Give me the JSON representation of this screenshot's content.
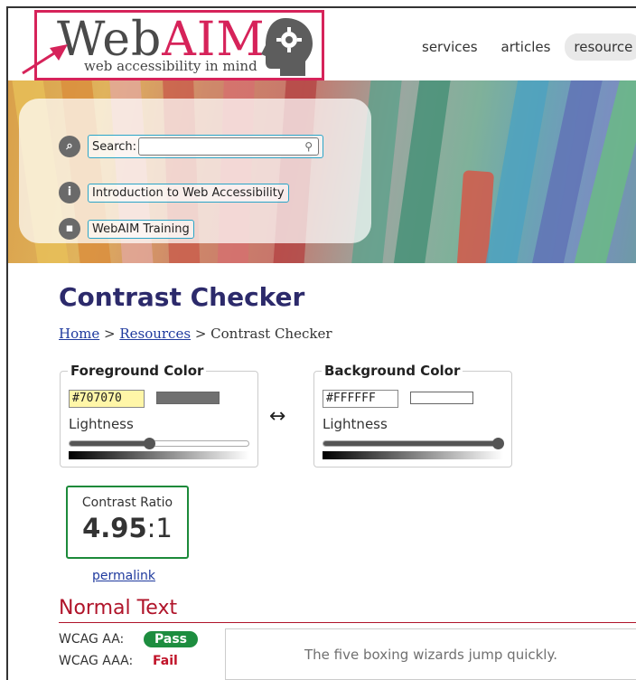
{
  "header": {
    "logo": {
      "word_web": "Web",
      "word_aim": "AIM",
      "tagline": "web accessibility in mind"
    },
    "nav": [
      {
        "label": "services",
        "active": false
      },
      {
        "label": "articles",
        "active": false
      },
      {
        "label": "resource",
        "active": true
      }
    ]
  },
  "banner": {
    "search_label": "Search:",
    "search_value": "",
    "links": [
      "Introduction to Web Accessibility",
      "WebAIM Training"
    ]
  },
  "main": {
    "page_title": "Contrast Checker",
    "breadcrumb": {
      "home": "Home",
      "sep1": " > ",
      "resources": "Resources",
      "sep2": " > ",
      "current": "Contrast Checker"
    },
    "foreground": {
      "legend": "Foreground Color",
      "hex": "#707070",
      "swatch": "#707070",
      "lightness_label": "Lightness",
      "lightness": 0.44
    },
    "background": {
      "legend": "Background Color",
      "hex": "#FFFFFF",
      "swatch": "#FFFFFF",
      "lightness_label": "Lightness",
      "lightness": 1.0
    },
    "swap_symbol": "↔",
    "contrast": {
      "label": "Contrast Ratio",
      "value": "4.95",
      "suffix": ":1"
    },
    "permalink": "permalink",
    "normal_text": {
      "title": "Normal Text",
      "aa_label": "WCAG AA:",
      "aa_result": "Pass",
      "aaa_label": "WCAG AAA:",
      "aaa_result": "Fail",
      "sample": "The five boxing wizards jump quickly."
    }
  },
  "colors": {
    "brand_pink": "#d6235a",
    "title_navy": "#2c2a6b",
    "pass_green": "#1d8d3f",
    "fail_red": "#c01228",
    "link_blue": "#1f3a9e"
  }
}
